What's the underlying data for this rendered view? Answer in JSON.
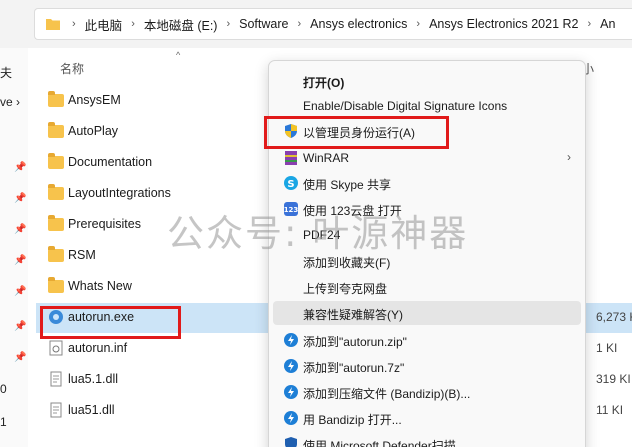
{
  "address": {
    "crumbs": [
      "此电脑",
      "本地磁盘 (E:)",
      "Software",
      "Ansys electronics",
      "Ansys Electronics 2021 R2",
      "An"
    ]
  },
  "nav": {
    "fragments": [
      "夫",
      "ve ›",
      "0",
      "1"
    ]
  },
  "list": {
    "name_header": "名称",
    "size_header_fragment": "小",
    "rows": [
      {
        "name": "AnsysEM",
        "type": "folder",
        "size": ""
      },
      {
        "name": "AutoPlay",
        "type": "folder",
        "size": ""
      },
      {
        "name": "Documentation",
        "type": "folder",
        "size": ""
      },
      {
        "name": "LayoutIntegrations",
        "type": "folder",
        "size": ""
      },
      {
        "name": "Prerequisites",
        "type": "folder",
        "size": ""
      },
      {
        "name": "RSM",
        "type": "folder",
        "size": ""
      },
      {
        "name": "Whats New",
        "type": "folder",
        "size": ""
      },
      {
        "name": "autorun.exe",
        "type": "exe",
        "size": "6,273 KI"
      },
      {
        "name": "autorun.inf",
        "type": "inf",
        "size": "1 KI"
      },
      {
        "name": "lua5.1.dll",
        "type": "dll",
        "size": "319 KI"
      },
      {
        "name": "lua51.dll",
        "type": "dll",
        "size": "11 KI"
      }
    ]
  },
  "context_menu": {
    "items": [
      {
        "label": "打开(O)",
        "icon": "none",
        "bold": true
      },
      {
        "label": "Enable/Disable Digital Signature Icons",
        "icon": "none"
      },
      {
        "label": "以管理员身份运行(A)",
        "icon": "shield-icon"
      },
      {
        "label": "WinRAR",
        "icon": "winrar-icon",
        "submenu": true
      },
      {
        "label": "使用 Skype 共享",
        "icon": "skype-icon"
      },
      {
        "label": "使用 123云盘 打开",
        "icon": "cloud123-icon"
      },
      {
        "label": "PDF24",
        "icon": "none"
      },
      {
        "label": "添加到收藏夹(F)",
        "icon": "none"
      },
      {
        "label": "上传到夸克网盘",
        "icon": "none"
      },
      {
        "label": "兼容性疑难解答(Y)",
        "icon": "none",
        "hover": true
      },
      {
        "label": "添加到\"autorun.zip\"",
        "icon": "bandizip-icon"
      },
      {
        "label": "添加到\"autorun.7z\"",
        "icon": "bandizip-icon"
      },
      {
        "label": "添加到压缩文件 (Bandizip)(B)...",
        "icon": "bandizip-icon"
      },
      {
        "label": "用 Bandizip 打开...",
        "icon": "bandizip-icon"
      },
      {
        "label": "使用 Microsoft Defender扫描...",
        "icon": "defender-icon"
      }
    ]
  },
  "watermark": "公众号: 叶源神器",
  "colors": {
    "highlight": "#e11a1a",
    "selection": "#cce4f7",
    "folder": "#f7c34c"
  }
}
